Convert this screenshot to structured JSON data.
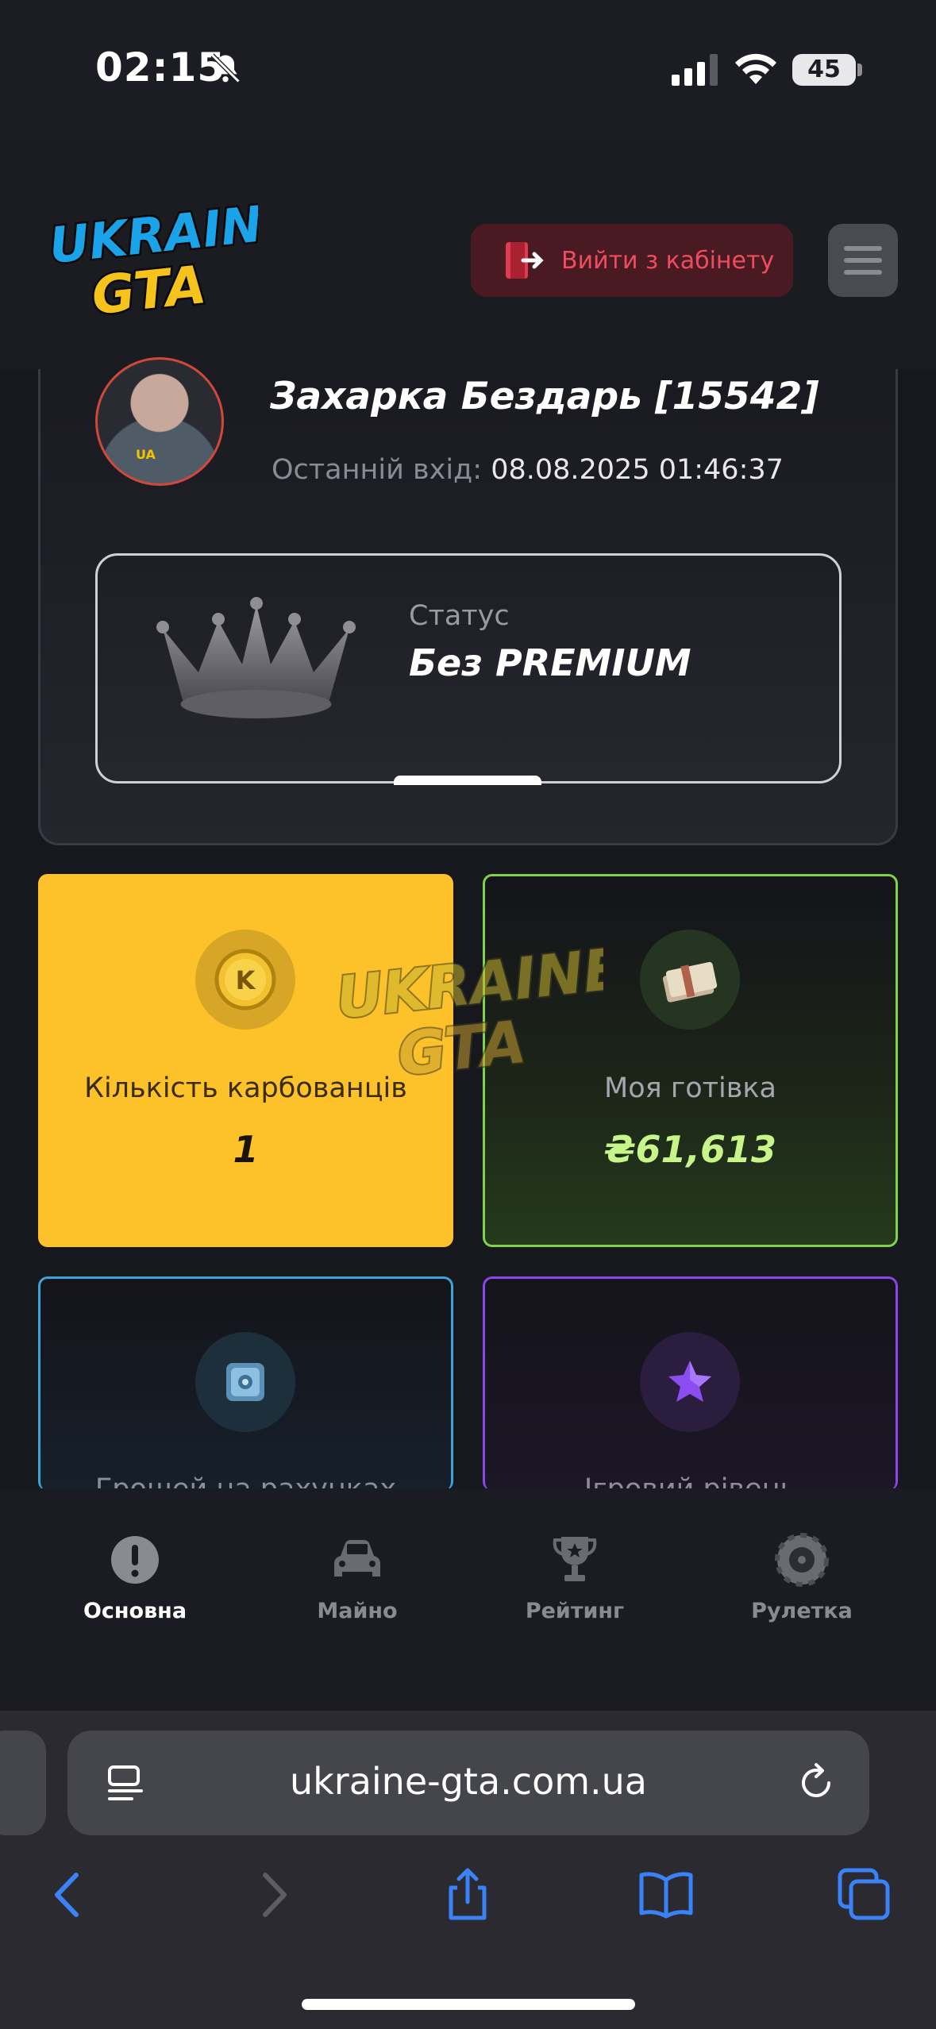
{
  "status_bar": {
    "time": "02:15",
    "battery": "45"
  },
  "header": {
    "logo": "UKRAINE GTA",
    "logout_label": "Вийти з кабінету"
  },
  "profile": {
    "name": "Захарка Бездарь [15542]",
    "last_login_label": "Останній вхід:",
    "last_login_value": "08.08.2025 01:46:37",
    "status_label": "Статус",
    "status_value": "Без PREMIUM"
  },
  "stats": {
    "coins_label": "Кількість карбованців",
    "coins_value": "1",
    "cash_label": "Моя готівка",
    "cash_value": "₴61,613",
    "bank_label": "Грошей на рахунках",
    "level_label": "Ігровий рівень"
  },
  "app_nav": [
    {
      "label": "Основна",
      "icon": "info-icon",
      "active": true
    },
    {
      "label": "Майно",
      "icon": "car-icon",
      "active": false
    },
    {
      "label": "Рейтинг",
      "icon": "trophy-icon",
      "active": false
    },
    {
      "label": "Рулетка",
      "icon": "roulette-icon",
      "active": false
    }
  ],
  "browser": {
    "url": "ukraine-gta.com.ua"
  },
  "colors": {
    "accent_yellow": "#fdc22a",
    "cash_green": "#b8f07a",
    "logout_red": "#ef4d5f",
    "safari_blue": "#3a82f7"
  }
}
